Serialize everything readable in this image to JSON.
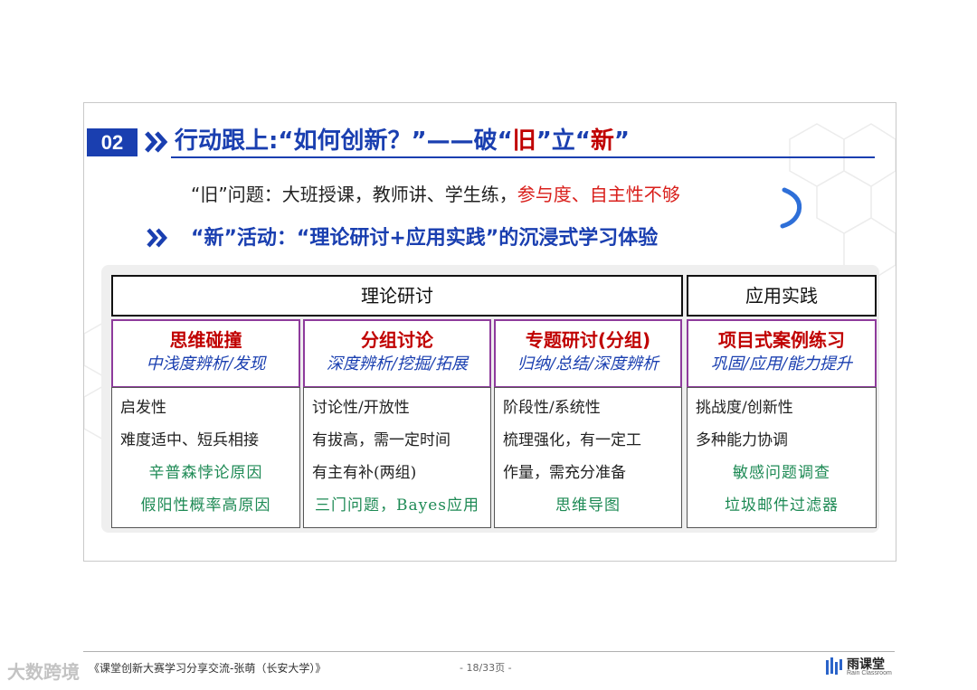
{
  "slide": {
    "number": "02",
    "title": {
      "part1": "行动跟上:“如何创新？”——破“",
      "old": "旧",
      "part2": "”立“",
      "new": "新",
      "part3": "”"
    },
    "old_line": {
      "text": "“旧”问题：大班授课，教师讲、学生练，",
      "highlight": "参与度、自主性不够"
    },
    "new_line": "“新”活动：“理论研讨+应用实践”的沉浸式学习体验",
    "categories": {
      "theory": "理论研讨",
      "practice": "应用实践"
    },
    "columns": [
      {
        "title": "思维碰撞",
        "subtitle": "中浅度辨析/发现",
        "items": [
          "启发性",
          "难度适中、短兵相接"
        ],
        "examples": [
          "辛普森悖论原因",
          "假阳性概率高原因"
        ]
      },
      {
        "title": "分组讨论",
        "subtitle": "深度辨析/挖掘/拓展",
        "items": [
          "讨论性/开放性",
          "有拔高，需一定时间",
          "有主有补(两组)"
        ],
        "examples": [
          "三门问题，Bayes应用"
        ]
      },
      {
        "title": "专题研讨(分组)",
        "subtitle": "归纳/总结/深度辨析",
        "items": [
          "阶段性/系统性",
          "梳理强化，有一定工",
          "作量，需充分准备"
        ],
        "examples": [
          "思维导图"
        ]
      },
      {
        "title": "项目式案例练习",
        "subtitle": "巩固/应用/能力提升",
        "items": [
          "挑战度/创新性",
          "多种能力协调"
        ],
        "examples": [
          "敏感问题调查",
          "垃圾邮件过滤器"
        ]
      }
    ]
  },
  "footer": {
    "text": "《课堂创新大赛学习分享交流-张萌（长安大学）》",
    "page": "- 18/33页 -",
    "logo_name": "雨课堂",
    "logo_sub": "Rain Classroom",
    "watermark": "大数跨境"
  },
  "colors": {
    "blue": "#1a3fb0",
    "red": "#c00000",
    "purple": "#8e3b9c",
    "green": "#1e8a55"
  }
}
